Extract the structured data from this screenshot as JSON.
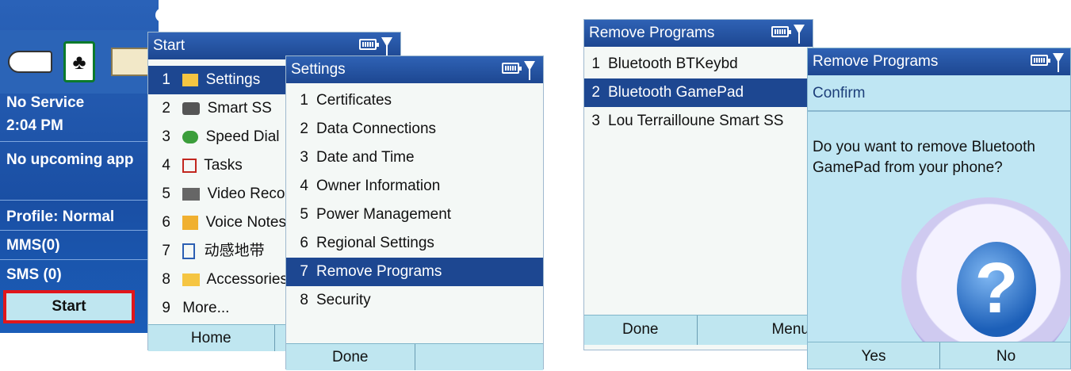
{
  "home": {
    "status_lines": [
      "No Service",
      "2:04 PM",
      "No upcoming app",
      "Profile: Normal",
      "MMS(0)",
      "SMS (0)"
    ],
    "start_label": "Start"
  },
  "start_menu": {
    "title": "Start",
    "items": [
      {
        "num": "1",
        "label": "Settings",
        "icon": "folder-settings-icon"
      },
      {
        "num": "2",
        "label": "Smart SS",
        "icon": "camera-icon"
      },
      {
        "num": "3",
        "label": "Speed Dial",
        "icon": "speed-dial-icon"
      },
      {
        "num": "4",
        "label": "Tasks",
        "icon": "tasks-icon"
      },
      {
        "num": "5",
        "label": "Video Recor",
        "icon": "video-icon"
      },
      {
        "num": "6",
        "label": "Voice Notes",
        "icon": "voice-notes-icon"
      },
      {
        "num": "7",
        "label": "动感地带",
        "icon": "document-icon"
      },
      {
        "num": "8",
        "label": "Accessories",
        "icon": "folder-icon"
      },
      {
        "num": "9",
        "label": "More..."
      }
    ],
    "softkey_left": "Home"
  },
  "settings_menu": {
    "title": "Settings",
    "items": [
      {
        "num": "1",
        "label": "Certificates"
      },
      {
        "num": "2",
        "label": "Data Connections"
      },
      {
        "num": "3",
        "label": "Date and Time"
      },
      {
        "num": "4",
        "label": "Owner Information"
      },
      {
        "num": "5",
        "label": "Power Management"
      },
      {
        "num": "6",
        "label": "Regional Settings"
      },
      {
        "num": "7",
        "label": "Remove Programs"
      },
      {
        "num": "8",
        "label": "Security"
      }
    ],
    "selected_index": 6,
    "softkey_left": "Done"
  },
  "remove_programs": {
    "title": "Remove Programs",
    "items": [
      {
        "num": "1",
        "label": "Bluetooth BTKeybd"
      },
      {
        "num": "2",
        "label": "Bluetooth GamePad"
      },
      {
        "num": "3",
        "label": "Lou Terrailloune Smart SS"
      }
    ],
    "selected_index": 1,
    "softkey_left": "Done",
    "softkey_right": "Menu"
  },
  "confirm_dialog": {
    "title": "Remove Programs",
    "subtitle": "Confirm",
    "message": "Do you want to remove Bluetooth GamePad from your phone?",
    "yes_label": "Yes",
    "no_label": "No"
  },
  "colors": {
    "title_bar": "#1d4791",
    "selection": "#1d4791",
    "softbar": "#bfe6f0",
    "highlight_border": "#e0161b"
  }
}
